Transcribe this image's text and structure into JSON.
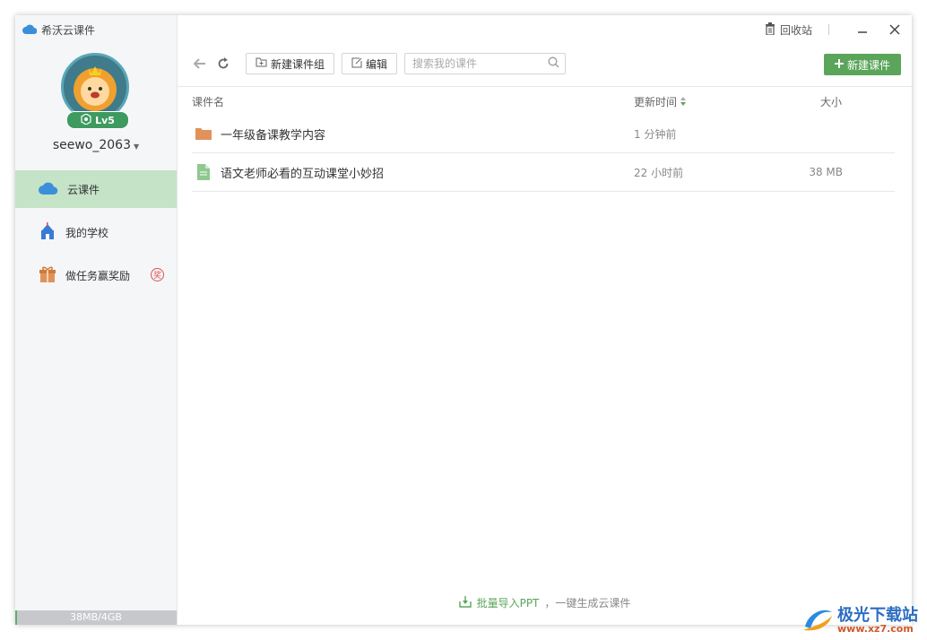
{
  "app": {
    "title": "希沃云课件"
  },
  "profile": {
    "level": "Lv5",
    "username": "seewo_2063"
  },
  "sidebar": {
    "items": [
      {
        "label": "云课件",
        "icon": "cloud-icon",
        "active": true
      },
      {
        "label": "我的学校",
        "icon": "school-icon",
        "active": false
      },
      {
        "label": "做任务赢奖励",
        "icon": "gift-icon",
        "active": false,
        "badge": "奖"
      }
    ],
    "storage": {
      "label": "38MB/4GB",
      "used_fraction": 0.01
    }
  },
  "titlebar": {
    "recycle_label": "回收站"
  },
  "toolbar": {
    "new_group_label": "新建课件组",
    "edit_label": "编辑",
    "search_placeholder": "搜索我的课件",
    "new_courseware_label": "新建课件"
  },
  "table": {
    "columns": {
      "name": "课件名",
      "time": "更新时间",
      "size": "大小"
    },
    "rows": [
      {
        "type": "folder",
        "name": "一年级备课教学内容",
        "time": "1 分钟前",
        "size": ""
      },
      {
        "type": "file",
        "name": "语文老师必看的互动课堂小妙招",
        "time": "22 小时前",
        "size": "38 MB"
      }
    ]
  },
  "footer": {
    "link": "批量导入PPT",
    "text": "，一键生成云课件"
  },
  "watermark": {
    "title": "极光下载站",
    "url": "www.xz7.com"
  },
  "colors": {
    "accent": "#5aa55a",
    "active_nav": "#c5e3c7",
    "folder": "#e0925a"
  }
}
